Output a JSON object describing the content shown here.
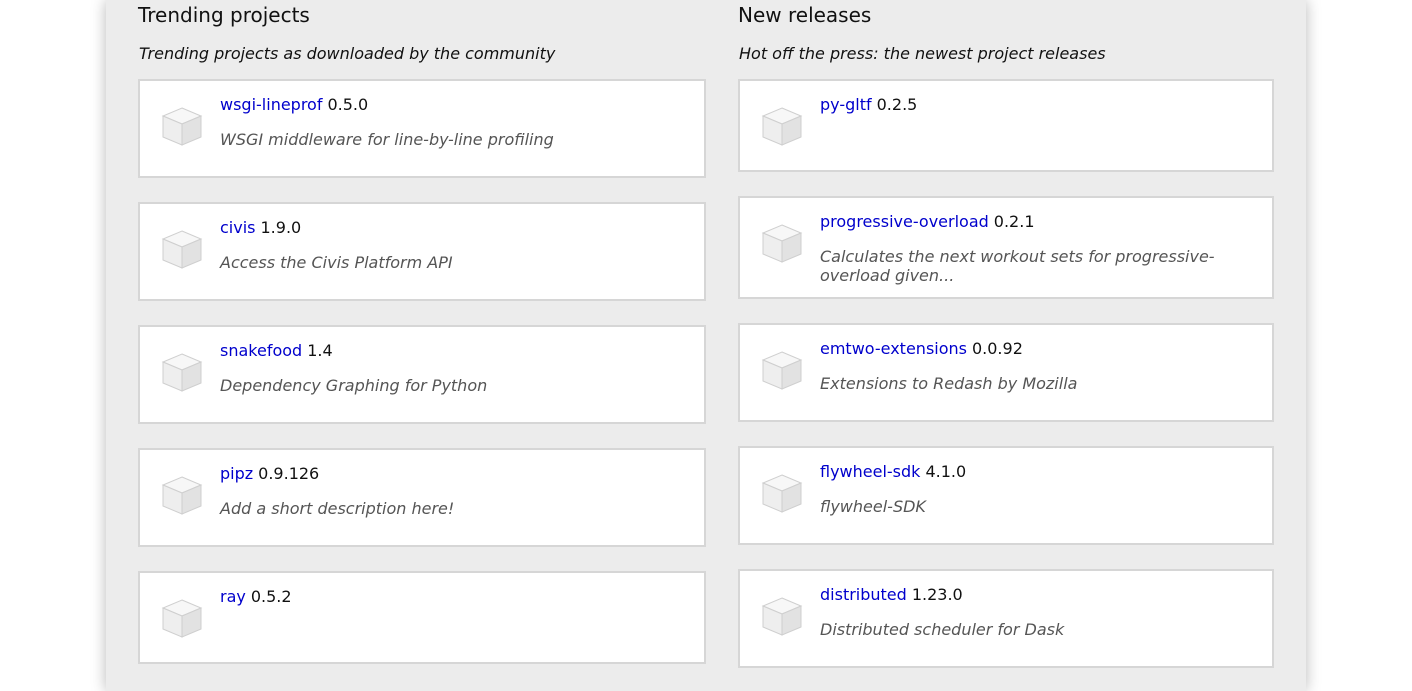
{
  "trending": {
    "title": "Trending projects",
    "subtitle": "Trending projects as downloaded by the community",
    "items": [
      {
        "name": "wsgi-lineprof",
        "version": "0.5.0",
        "description": "WSGI middleware for line-by-line profiling"
      },
      {
        "name": "civis",
        "version": "1.9.0",
        "description": "Access the Civis Platform API"
      },
      {
        "name": "snakefood",
        "version": "1.4",
        "description": "Dependency Graphing for Python"
      },
      {
        "name": "pipz",
        "version": "0.9.126",
        "description": "Add a short description here!"
      },
      {
        "name": "ray",
        "version": "0.5.2",
        "description": ""
      }
    ]
  },
  "new_releases": {
    "title": "New releases",
    "subtitle": "Hot off the press: the newest project releases",
    "items": [
      {
        "name": "py-gltf",
        "version": "0.2.5",
        "description": ""
      },
      {
        "name": "progressive-overload",
        "version": "0.2.1",
        "description": "Calculates the next workout sets for progressive-overload given..."
      },
      {
        "name": "emtwo-extensions",
        "version": "0.0.92",
        "description": "Extensions to Redash by Mozilla"
      },
      {
        "name": "flywheel-sdk",
        "version": "4.1.0",
        "description": "flywheel-SDK"
      },
      {
        "name": "distributed",
        "version": "1.23.0",
        "description": "Distributed scheduler for Dask"
      }
    ]
  },
  "icons": {
    "package": "package-cube-icon"
  },
  "colors": {
    "link": "#0000cc",
    "panel": "#ececec",
    "card_border": "#d6d6d6",
    "description": "#555555"
  }
}
